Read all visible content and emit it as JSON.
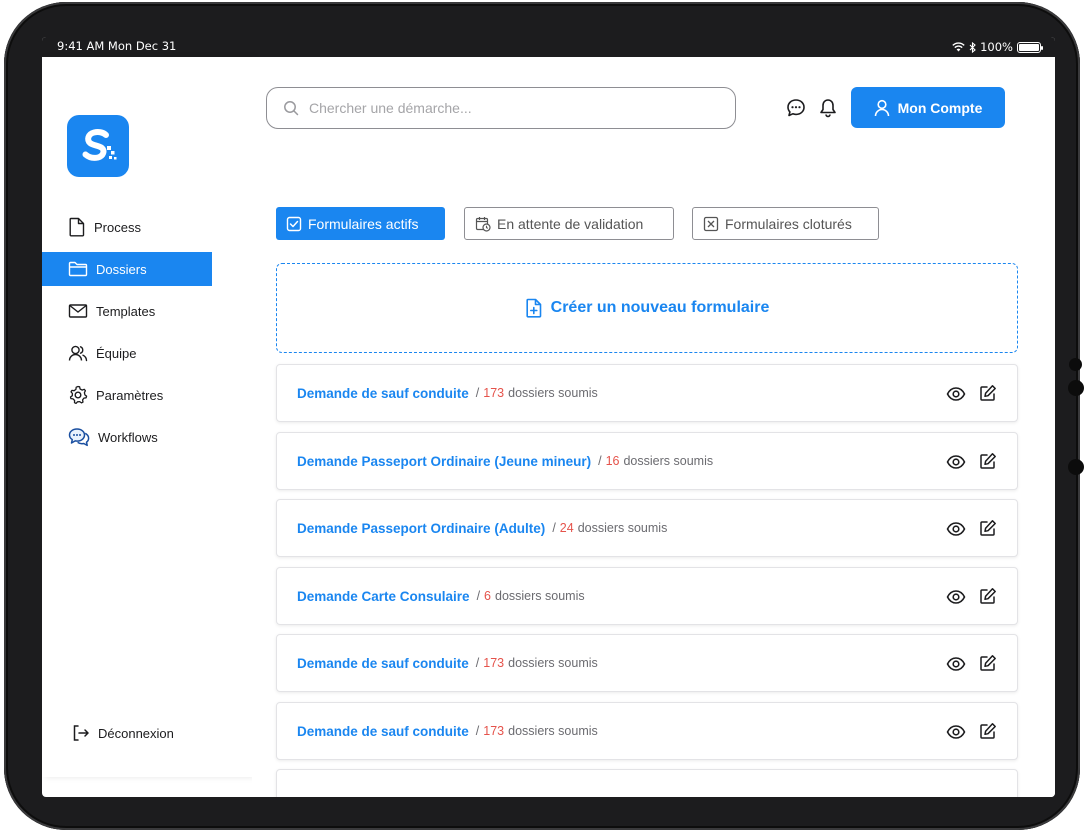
{
  "status_bar": {
    "time": "9:41 AM  Mon Dec 31",
    "battery": "100%"
  },
  "sidebar": {
    "items": [
      {
        "label": "Process",
        "icon": "document-icon",
        "active": false
      },
      {
        "label": "Dossiers",
        "icon": "folder-icon",
        "active": true
      },
      {
        "label": "Templates",
        "icon": "mail-icon",
        "active": false
      },
      {
        "label": "Équipe",
        "icon": "users-icon",
        "active": false
      },
      {
        "label": "Paramètres",
        "icon": "gear-icon",
        "active": false
      },
      {
        "label": "Workflows",
        "icon": "chat-bubbles-icon",
        "active": false
      }
    ],
    "logout_label": "Déconnexion"
  },
  "header": {
    "search_placeholder": "Chercher une démarche...",
    "account_label": "Mon Compte"
  },
  "tabs": [
    {
      "label": "Formulaires actifs",
      "active": true
    },
    {
      "label": "En attente de validation",
      "active": false
    },
    {
      "label": "Formulaires cloturés",
      "active": false
    }
  ],
  "create_label": "Créer un nouveau formulaire",
  "forms": [
    {
      "title": "Demande de sauf conduite",
      "sep": "/",
      "count": "173",
      "suffix": "dossiers soumis"
    },
    {
      "title": "Demande Passeport Ordinaire (Jeune mineur)",
      "sep": "/",
      "count": "16",
      "suffix": "dossiers soumis"
    },
    {
      "title": "Demande Passeport Ordinaire (Adulte)",
      "sep": "/",
      "count": "24",
      "suffix": "dossiers soumis"
    },
    {
      "title": "Demande Carte Consulaire",
      "sep": "/",
      "count": "6",
      "suffix": "dossiers soumis"
    },
    {
      "title": "Demande de sauf conduite",
      "sep": "/",
      "count": "173",
      "suffix": "dossiers soumis"
    },
    {
      "title": "Demande de sauf conduite",
      "sep": "/",
      "count": "173",
      "suffix": "dossiers soumis"
    }
  ],
  "colors": {
    "accent": "#1a86f0",
    "count": "#e5534b",
    "frame": "#1c1c1e"
  }
}
